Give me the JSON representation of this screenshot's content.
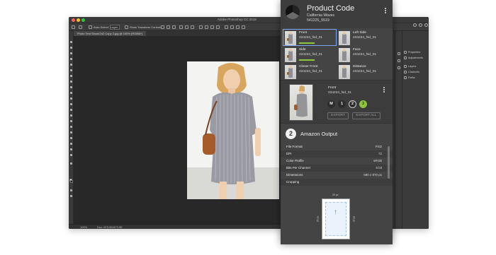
{
  "photoshop": {
    "window_title": "Adobe Photoshop CC 2018",
    "options_bar": {
      "auto_select_label": "Auto-Select:",
      "auto_select_value": "Layer",
      "show_transform_label": "Show Transform Controls"
    },
    "document_tab": "Photo Test Shoot/242 Copy 2.jpg @ 100% (RGB/8*)",
    "status": {
      "zoom": "100%",
      "doc_size": "Doc: 873.9K/873.9K"
    },
    "right_dock": {
      "items": [
        {
          "label": "Properties"
        },
        {
          "label": "Adjustments"
        },
        {
          "label": "Layers"
        },
        {
          "label": "Channels"
        },
        {
          "label": "Paths"
        }
      ]
    }
  },
  "panel": {
    "title": "Product Code",
    "subtitle": "California Waves",
    "code": "541225_5519",
    "thumbnails": [
      {
        "name": "Front",
        "code": "234234_fsd_01",
        "progress": 1,
        "active": true
      },
      {
        "name": "Left Side",
        "code": "234234_fsd_01",
        "progress": 0,
        "active": false
      },
      {
        "name": "Side",
        "code": "234234_fsd_01",
        "progress": 1,
        "active": false
      },
      {
        "name": "Face",
        "code": "234234_fsd_01",
        "progress": 0,
        "active": false
      },
      {
        "name": "Closer Front",
        "code": "234234_fsd_01",
        "progress": 0,
        "active": false
      },
      {
        "name": "Distance",
        "code": "234234_fsd_01",
        "progress": 0,
        "active": false
      }
    ],
    "detail": {
      "name": "Front",
      "code": "234234_fsd_01",
      "buttons": [
        "M",
        "1",
        "2",
        "3"
      ],
      "export_label": "EXPORT",
      "export_all_label": "EXPORT ALL"
    },
    "output": {
      "number": "2",
      "title": "Amazon Output",
      "properties": [
        {
          "key": "File Format",
          "value": "PSD"
        },
        {
          "key": "DPI",
          "value": "72"
        },
        {
          "key": "Color Profile",
          "value": "sRGB"
        },
        {
          "key": "Bits Per Channel",
          "value": "8 bit"
        },
        {
          "key": "Dimensions",
          "value": "580 x 870 px"
        },
        {
          "key": "Cropping",
          "value": ""
        }
      ],
      "crop_top": "20 px",
      "crop_left": "20 px",
      "crop_right": "20 px"
    },
    "colors": {
      "accent_green": "#8ec63f",
      "active_border": "#7da7ff"
    }
  }
}
